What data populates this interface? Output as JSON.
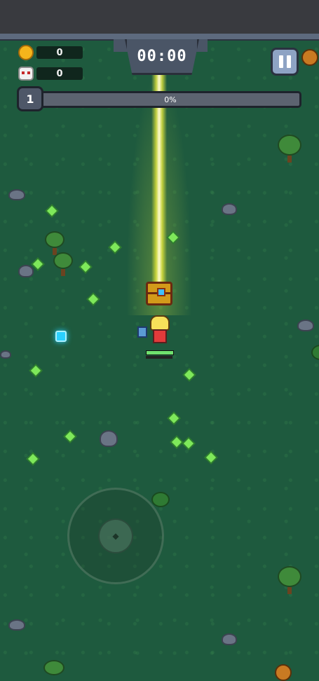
{
  "hud": {
    "timer": "00:00",
    "coins": "0",
    "kills": "0",
    "level": "1",
    "xp_percent_label": "0%",
    "xp_fraction": 0
  },
  "player": {
    "hp_fraction": 1.0,
    "xp_fraction": 0.0
  },
  "icons": {
    "coin": "coin-icon",
    "kills": "skull-icon",
    "pause": "pause-icon"
  },
  "colors": {
    "grass": "#1e5a3e",
    "xp_gem": "#7ee85a",
    "beam": "#f0f03c",
    "hp": "#6ee06e"
  }
}
